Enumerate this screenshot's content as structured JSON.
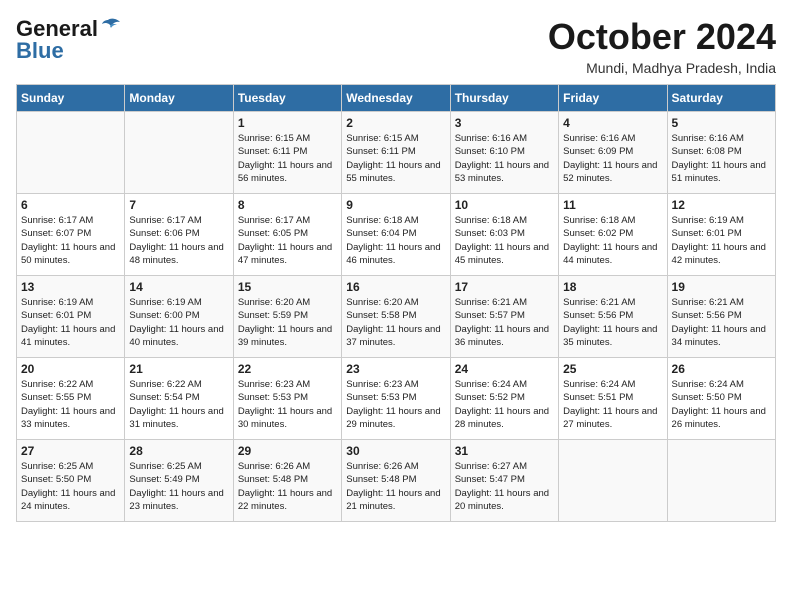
{
  "logo": {
    "line1": "General",
    "line2": "Blue"
  },
  "title": "October 2024",
  "location": "Mundi, Madhya Pradesh, India",
  "weekdays": [
    "Sunday",
    "Monday",
    "Tuesday",
    "Wednesday",
    "Thursday",
    "Friday",
    "Saturday"
  ],
  "weeks": [
    [
      {
        "day": "",
        "info": ""
      },
      {
        "day": "",
        "info": ""
      },
      {
        "day": "1",
        "info": "Sunrise: 6:15 AM\nSunset: 6:11 PM\nDaylight: 11 hours and 56 minutes."
      },
      {
        "day": "2",
        "info": "Sunrise: 6:15 AM\nSunset: 6:11 PM\nDaylight: 11 hours and 55 minutes."
      },
      {
        "day": "3",
        "info": "Sunrise: 6:16 AM\nSunset: 6:10 PM\nDaylight: 11 hours and 53 minutes."
      },
      {
        "day": "4",
        "info": "Sunrise: 6:16 AM\nSunset: 6:09 PM\nDaylight: 11 hours and 52 minutes."
      },
      {
        "day": "5",
        "info": "Sunrise: 6:16 AM\nSunset: 6:08 PM\nDaylight: 11 hours and 51 minutes."
      }
    ],
    [
      {
        "day": "6",
        "info": "Sunrise: 6:17 AM\nSunset: 6:07 PM\nDaylight: 11 hours and 50 minutes."
      },
      {
        "day": "7",
        "info": "Sunrise: 6:17 AM\nSunset: 6:06 PM\nDaylight: 11 hours and 48 minutes."
      },
      {
        "day": "8",
        "info": "Sunrise: 6:17 AM\nSunset: 6:05 PM\nDaylight: 11 hours and 47 minutes."
      },
      {
        "day": "9",
        "info": "Sunrise: 6:18 AM\nSunset: 6:04 PM\nDaylight: 11 hours and 46 minutes."
      },
      {
        "day": "10",
        "info": "Sunrise: 6:18 AM\nSunset: 6:03 PM\nDaylight: 11 hours and 45 minutes."
      },
      {
        "day": "11",
        "info": "Sunrise: 6:18 AM\nSunset: 6:02 PM\nDaylight: 11 hours and 44 minutes."
      },
      {
        "day": "12",
        "info": "Sunrise: 6:19 AM\nSunset: 6:01 PM\nDaylight: 11 hours and 42 minutes."
      }
    ],
    [
      {
        "day": "13",
        "info": "Sunrise: 6:19 AM\nSunset: 6:01 PM\nDaylight: 11 hours and 41 minutes."
      },
      {
        "day": "14",
        "info": "Sunrise: 6:19 AM\nSunset: 6:00 PM\nDaylight: 11 hours and 40 minutes."
      },
      {
        "day": "15",
        "info": "Sunrise: 6:20 AM\nSunset: 5:59 PM\nDaylight: 11 hours and 39 minutes."
      },
      {
        "day": "16",
        "info": "Sunrise: 6:20 AM\nSunset: 5:58 PM\nDaylight: 11 hours and 37 minutes."
      },
      {
        "day": "17",
        "info": "Sunrise: 6:21 AM\nSunset: 5:57 PM\nDaylight: 11 hours and 36 minutes."
      },
      {
        "day": "18",
        "info": "Sunrise: 6:21 AM\nSunset: 5:56 PM\nDaylight: 11 hours and 35 minutes."
      },
      {
        "day": "19",
        "info": "Sunrise: 6:21 AM\nSunset: 5:56 PM\nDaylight: 11 hours and 34 minutes."
      }
    ],
    [
      {
        "day": "20",
        "info": "Sunrise: 6:22 AM\nSunset: 5:55 PM\nDaylight: 11 hours and 33 minutes."
      },
      {
        "day": "21",
        "info": "Sunrise: 6:22 AM\nSunset: 5:54 PM\nDaylight: 11 hours and 31 minutes."
      },
      {
        "day": "22",
        "info": "Sunrise: 6:23 AM\nSunset: 5:53 PM\nDaylight: 11 hours and 30 minutes."
      },
      {
        "day": "23",
        "info": "Sunrise: 6:23 AM\nSunset: 5:53 PM\nDaylight: 11 hours and 29 minutes."
      },
      {
        "day": "24",
        "info": "Sunrise: 6:24 AM\nSunset: 5:52 PM\nDaylight: 11 hours and 28 minutes."
      },
      {
        "day": "25",
        "info": "Sunrise: 6:24 AM\nSunset: 5:51 PM\nDaylight: 11 hours and 27 minutes."
      },
      {
        "day": "26",
        "info": "Sunrise: 6:24 AM\nSunset: 5:50 PM\nDaylight: 11 hours and 26 minutes."
      }
    ],
    [
      {
        "day": "27",
        "info": "Sunrise: 6:25 AM\nSunset: 5:50 PM\nDaylight: 11 hours and 24 minutes."
      },
      {
        "day": "28",
        "info": "Sunrise: 6:25 AM\nSunset: 5:49 PM\nDaylight: 11 hours and 23 minutes."
      },
      {
        "day": "29",
        "info": "Sunrise: 6:26 AM\nSunset: 5:48 PM\nDaylight: 11 hours and 22 minutes."
      },
      {
        "day": "30",
        "info": "Sunrise: 6:26 AM\nSunset: 5:48 PM\nDaylight: 11 hours and 21 minutes."
      },
      {
        "day": "31",
        "info": "Sunrise: 6:27 AM\nSunset: 5:47 PM\nDaylight: 11 hours and 20 minutes."
      },
      {
        "day": "",
        "info": ""
      },
      {
        "day": "",
        "info": ""
      }
    ]
  ]
}
